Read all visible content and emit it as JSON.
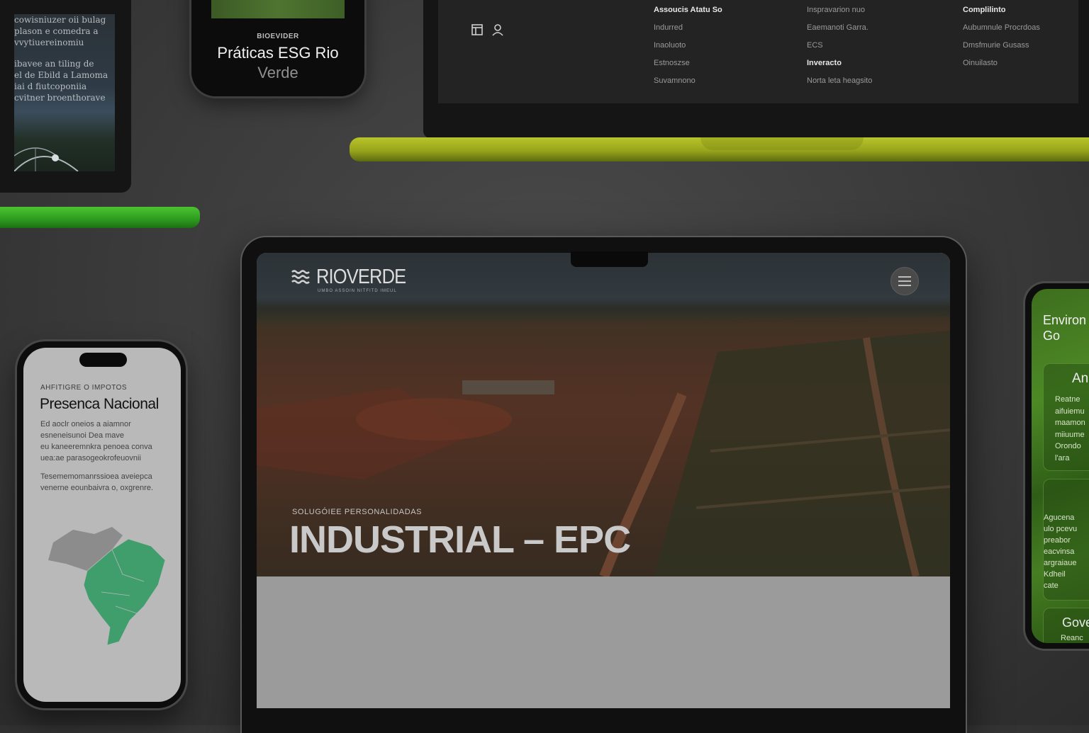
{
  "top_left_laptop": {
    "lines": [
      "cowisniuzer oii  bulag",
      "plason  e  comedra a",
      "vvytiuereinomiu",
      "",
      "ibavee  an  tiling de",
      "el  de  Ebild  a  Lamoma",
      "iai d  fiutcoponiia",
      "cvitner broenthorave"
    ],
    "colors": {
      "base": "#2d9b1f"
    }
  },
  "top_phone": {
    "label": "BIOEVIDER",
    "title": "Práticas ESG Rio",
    "subtitle": "Verde"
  },
  "top_right_laptop": {
    "columns": [
      {
        "header": "Assoucis Atatu So",
        "items": [
          "Indurred",
          "Inaoluoto",
          "Estnoszse",
          "Suvamnono"
        ]
      },
      {
        "header": "",
        "items": [
          "Inspravarion nuo",
          "Eaemanoti Garra.",
          "ECS",
          "Inveracto",
          "Norta leta heagsito"
        ],
        "bold_item": "Inveracto"
      },
      {
        "header": "Complilinto",
        "items": [
          "Aubumnule Procrdoas",
          "Dmsfmurie Gusass",
          "Oinuilasto"
        ]
      }
    ],
    "icons": [
      "calendar-icon",
      "user-icon"
    ],
    "colors": {
      "base": "#98a51c"
    }
  },
  "main_laptop": {
    "brand": "RIOVERDE",
    "brand_tagline": "UMBO ASSOIN NITFITD IMEUL",
    "hero_kicker": "SOLUGÓIEE PERSONALIDADAS",
    "hero_title": "INDUSTRIAL – EPC",
    "menu_icon": "hamburger-icon"
  },
  "left_phone": {
    "kicker": "AHFITIGRE O IMPOTOS",
    "title": "Presenca Nacional",
    "para1": [
      "Ed aoclr oneios a aiamnor",
      "esneneisunoi Dea mave",
      "eu kaneeremnkra penoea conva",
      "uea:ae parasogeokrofeuovnii"
    ],
    "para2": [
      "Tesememomanrssioea aveiepca",
      "venerne eounbaivra o, oxgrenre."
    ],
    "map_colors": {
      "highlight": "#3f9e6c",
      "base": "#8c8c8c"
    }
  },
  "right_phone": {
    "heading": "Environ and Go",
    "card1_title": "An",
    "card1_lines": [
      "Reatne",
      "aifuiemu",
      "maamon",
      "miiuume",
      "Orondo",
      "l'ara"
    ],
    "card2_lines": [
      "Agucena",
      "ulo pcevu",
      "preabor",
      "eacvinsa",
      "argraiaue",
      "Kdheil",
      "cate"
    ],
    "card3_title": "Gove",
    "card3_sub": "Reanc"
  }
}
